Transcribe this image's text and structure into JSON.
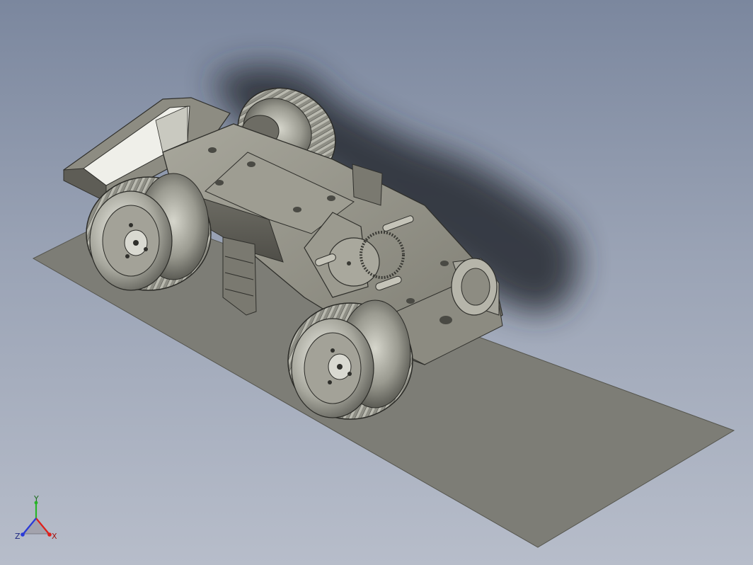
{
  "viewport": {
    "background_top": "#7b879e",
    "background_bottom": "#b7bdca",
    "ground_color": "#7d7d76",
    "model_color": "#8f8e84",
    "shadow_color": "#262a33"
  },
  "model": {
    "name": "",
    "parts": [
      "ground-plane",
      "chassis",
      "front-bin",
      "gearbox",
      "motor",
      "wheel-front-left",
      "wheel-rear-left",
      "wheel-rear-right"
    ]
  },
  "triad": {
    "x_label": "X",
    "y_label": "Y",
    "z_label": "Z",
    "x_color": "#e0201a",
    "y_color": "#28b428",
    "z_color": "#2a3ad8"
  }
}
